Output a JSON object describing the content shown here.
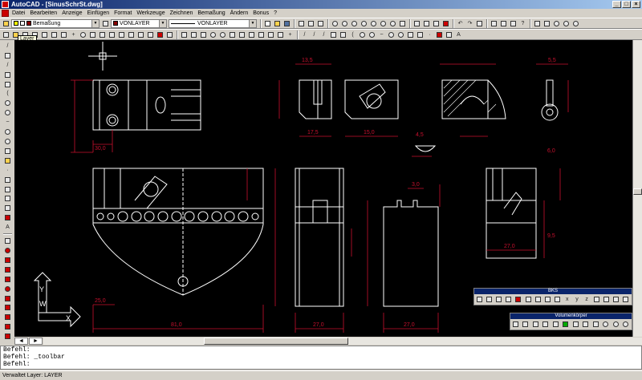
{
  "window": {
    "title": "AutoCAD - [SinusSchrSt.dwg]"
  },
  "menu": [
    "Datei",
    "Bearbeiten",
    "Anzeige",
    "Einfügen",
    "Format",
    "Werkzeuge",
    "Zeichnen",
    "Bemaßung",
    "Ändern",
    "Bonus",
    "?"
  ],
  "layer_combo": {
    "value": "Bemaßung"
  },
  "color_combo": {
    "value": "VONLAYER"
  },
  "linetype_combo": {
    "value": "VONLAYER"
  },
  "tooltip": "Layer",
  "float_toolbars": {
    "ucs": "BKS",
    "solids": "Volumenkörper"
  },
  "command": {
    "lines": [
      "Befehl:",
      "Befehl: _toolbar",
      "Befehl:"
    ]
  },
  "status": "Verwaltet Layer:  LAYER",
  "ucs_icon": {
    "x": "X",
    "y": "Y",
    "w": "W"
  },
  "colors": {
    "canvas": "#000000",
    "geometry": "#ffffff",
    "dimension": "#c8102e"
  },
  "drawing": {
    "dims": {
      "top_side_30": "30,0",
      "top_front_13": "13,5",
      "top_front_w": "17,5",
      "top_right_w": "15,0",
      "main_side_width": "81,0",
      "front_view_1": "27,0",
      "front_view_2": "27,0",
      "side_view_w": "27,0",
      "bottom_left": "25,0",
      "small_right_1": "5,5",
      "small_right_2": "6,0",
      "small_right_3": "9,5",
      "small_detail_1": "4,5",
      "small_detail_2": "3,0"
    }
  }
}
